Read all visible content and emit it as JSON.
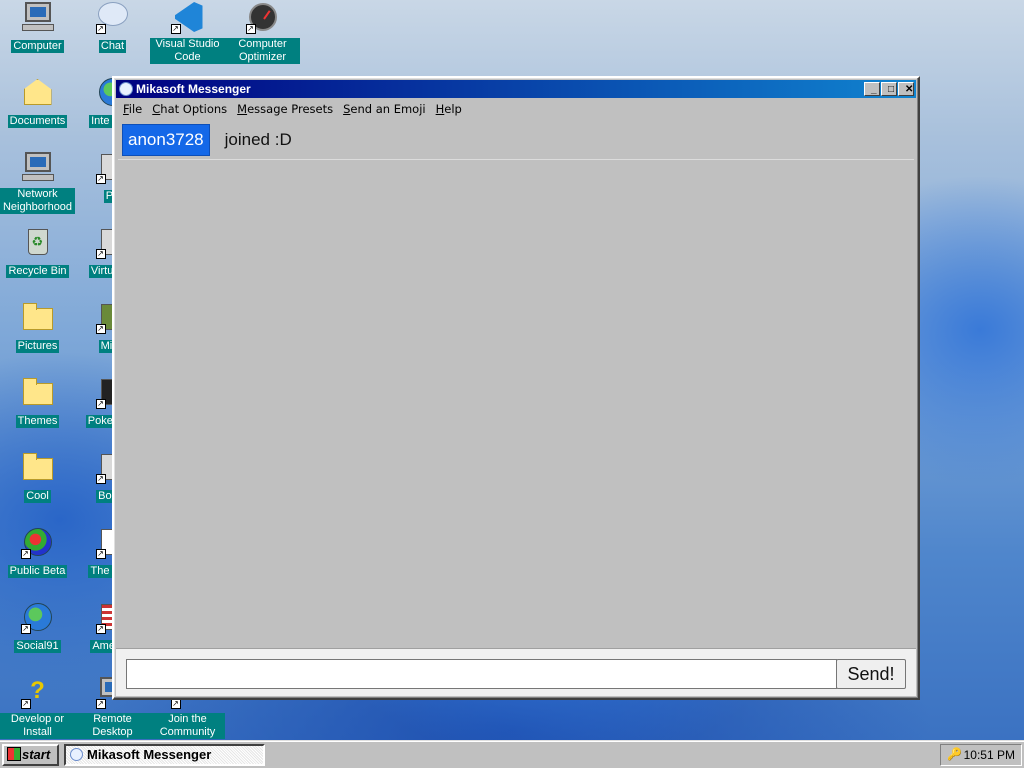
{
  "desktop": {
    "icons": [
      {
        "label": "Computer",
        "icon": "computer-icon"
      },
      {
        "label": "Chat",
        "icon": "chat-icon"
      },
      {
        "label": "Visual Studio Code",
        "icon": "vscode-icon"
      },
      {
        "label": "Computer Optimizer",
        "icon": "optimizer-icon"
      },
      {
        "label": "Documents",
        "icon": "documents-folder-icon"
      },
      {
        "label": "Inte Expl",
        "icon": "internet-explorer-icon"
      },
      {
        "label": "Network Neighborhood",
        "icon": "network-icon"
      },
      {
        "label": "Pa",
        "icon": "paint-icon"
      },
      {
        "label": "Recycle Bin",
        "icon": "recycle-bin-icon"
      },
      {
        "label": "Virtual M",
        "icon": "virtual-machine-icon"
      },
      {
        "label": "Pictures",
        "icon": "pictures-folder-icon"
      },
      {
        "label": "Mine",
        "icon": "minecraft-icon"
      },
      {
        "label": "Themes",
        "icon": "themes-folder-icon"
      },
      {
        "label": "Poke Plati",
        "icon": "pokemon-icon"
      },
      {
        "label": "Cool",
        "icon": "cool-folder-icon"
      },
      {
        "label": "Bomb",
        "icon": "bomb-icon"
      },
      {
        "label": "Public Beta",
        "icon": "public-beta-icon"
      },
      {
        "label": "The Desi",
        "icon": "designer-icon"
      },
      {
        "label": "Social91",
        "icon": "globe-icon"
      },
      {
        "label": "America",
        "icon": "america-flag-icon"
      },
      {
        "label": "Develop or Install",
        "icon": "help-question-icon"
      },
      {
        "label": "Remote Desktop",
        "icon": "remote-desktop-icon"
      },
      {
        "label": "Join the Community",
        "icon": "community-icon"
      }
    ]
  },
  "window": {
    "title": "Mikasoft Messenger",
    "controls": {
      "minimize": "_",
      "maximize": "□",
      "close": "✕"
    },
    "menu": [
      {
        "accel": "F",
        "rest": "ile"
      },
      {
        "accel": "C",
        "rest": "hat Options"
      },
      {
        "accel": "M",
        "rest": "essage Presets"
      },
      {
        "accel": "S",
        "rest": "end an Emoji"
      },
      {
        "accel": "H",
        "rest": "elp"
      }
    ],
    "messages": [
      {
        "user": "anon3728",
        "text": "joined :D"
      }
    ],
    "input": {
      "value": "",
      "placeholder": ""
    },
    "send_label": "Send!"
  },
  "taskbar": {
    "start_label": "start",
    "tasks": [
      {
        "label": "Mikasoft Messenger"
      }
    ],
    "clock": "10:51 PM"
  },
  "colors": {
    "titlebar_start": "#000080",
    "titlebar_end": "#1084d0",
    "username_badge": "#1468e8",
    "desktop_label_bg": "#008080"
  }
}
